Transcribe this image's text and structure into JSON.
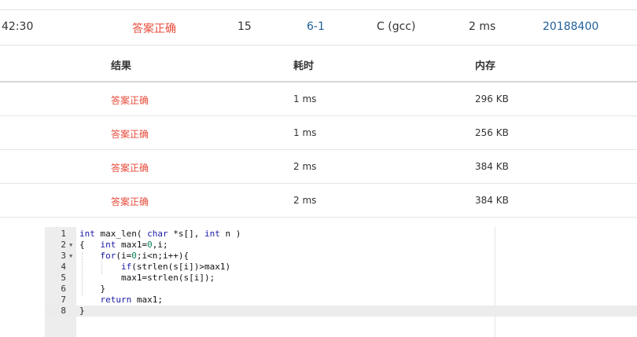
{
  "summary": {
    "time": "42:30",
    "status": "答案正确",
    "score": "15",
    "problem": "6-1",
    "compiler": "C (gcc)",
    "runtime": "2 ms",
    "user": "20188400"
  },
  "tests": {
    "headers": {
      "result": "结果",
      "time": "耗时",
      "memory": "内存"
    },
    "rows": [
      {
        "result": "答案正确",
        "time": "1 ms",
        "memory": "296 KB"
      },
      {
        "result": "答案正确",
        "time": "1 ms",
        "memory": "256 KB"
      },
      {
        "result": "答案正确",
        "time": "2 ms",
        "memory": "384 KB"
      },
      {
        "result": "答案正确",
        "time": "2 ms",
        "memory": "384 KB"
      }
    ]
  },
  "code": {
    "line_numbers": [
      "1",
      "2",
      "3",
      "4",
      "5",
      "6",
      "7",
      "8"
    ],
    "lines": [
      "int max_len( char *s[], int n )",
      "{   int max1=0,i;",
      "    for(i=0;i<n;i++){",
      "        if(strlen(s[i])>max1)",
      "        max1=strlen(s[i]);",
      "    }",
      "    return max1;",
      "}"
    ],
    "active_line": 8
  }
}
